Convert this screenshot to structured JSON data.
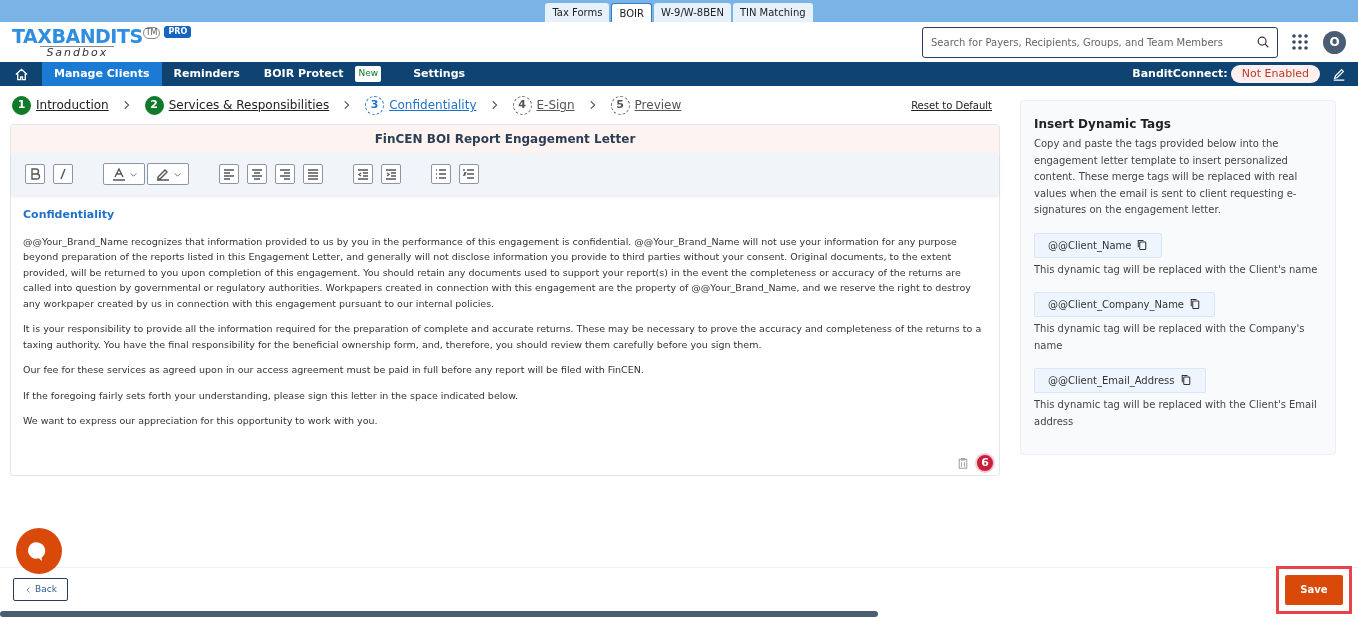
{
  "product_tabs": [
    {
      "label": "Tax Forms",
      "selected": false
    },
    {
      "label": "BOIR",
      "selected": true
    },
    {
      "label": "W-9/W-8BEN",
      "selected": false
    },
    {
      "label": "TIN Matching",
      "selected": false
    }
  ],
  "logo": {
    "brand": "TAXBANDITS",
    "tm": "TM",
    "sub": "Sandbox",
    "badge": "PRO"
  },
  "search": {
    "placeholder": "Search for Payers, Recipients, Groups, and Team Members"
  },
  "avatar": "O",
  "nav": [
    {
      "label": "Manage Clients",
      "selected": true
    },
    {
      "label": "Reminders",
      "selected": false
    },
    {
      "label": "BOIR Protect",
      "selected": false,
      "badge": "New"
    },
    {
      "label": "Settings",
      "selected": false
    }
  ],
  "bandit_connect": {
    "label": "BanditConnect:",
    "status": "Not Enabled"
  },
  "steps": [
    {
      "number": "1",
      "label": "Introduction",
      "kind": "done"
    },
    {
      "number": "2",
      "label": "Services & Responsibilities",
      "kind": "done"
    },
    {
      "number": "3",
      "label": "Confidentiality",
      "kind": "current"
    },
    {
      "number": "4",
      "label": "E-Sign",
      "kind": "todo"
    },
    {
      "number": "5",
      "label": "Preview",
      "kind": "todo"
    }
  ],
  "reset_link": "Reset to Default",
  "editor": {
    "title": "FinCEN BOI Report Engagement Letter",
    "heading": "Confidentiality",
    "paragraphs": [
      "@@Your_Brand_Name recognizes that information provided to us by you in the performance of this engagement is confidential. @@Your_Brand_Name will not use your information for any purpose beyond preparation of the reports listed in this Engagement Letter, and generally will not disclose information you provide to third parties without your consent. Original documents, to the extent provided, will be returned to you upon completion of this engagement. You should retain any documents used to support your report(s) in the event the completeness or accuracy of the returns are called into question by governmental or regulatory authorities. Workpapers created in connection with this engagement are the property of @@Your_Brand_Name, and we reserve the right to destroy any workpaper created by us in connection with this engagement pursuant to our internal policies.",
      "It is your responsibility to provide all the information required for the preparation of complete and accurate returns. These may be necessary to prove the accuracy and completeness of the returns to a taxing authority. You have the final responsibility for the beneficial ownership form, and, therefore, you should review them carefully before you sign them.",
      "Our fee for these services as agreed upon in our access agreement must be paid in full before any report will be filed with FinCEN.",
      "If the foregoing fairly sets forth your understanding, please sign this letter in the space indicated below.",
      "We want to express our appreciation for this opportunity to work with you."
    ],
    "issue_count": "6"
  },
  "tags_panel": {
    "title": "Insert Dynamic Tags",
    "description": "Copy and paste the tags provided below into the engagement letter template to insert personalized content. These merge tags will be replaced with real values when the email is sent to client requesting e-signatures on the engagement letter.",
    "tags": [
      {
        "tag": "@@Client_Name",
        "note": "This dynamic tag will be replaced with the Client's name"
      },
      {
        "tag": "@@Client_Company_Name",
        "note": "This dynamic tag will be replaced with the Company's name"
      },
      {
        "tag": "@@Client_Email_Address",
        "note": "This dynamic tag will be replaced with the Client's Email address"
      }
    ]
  },
  "footer": {
    "back": "Back",
    "save": "Save"
  }
}
